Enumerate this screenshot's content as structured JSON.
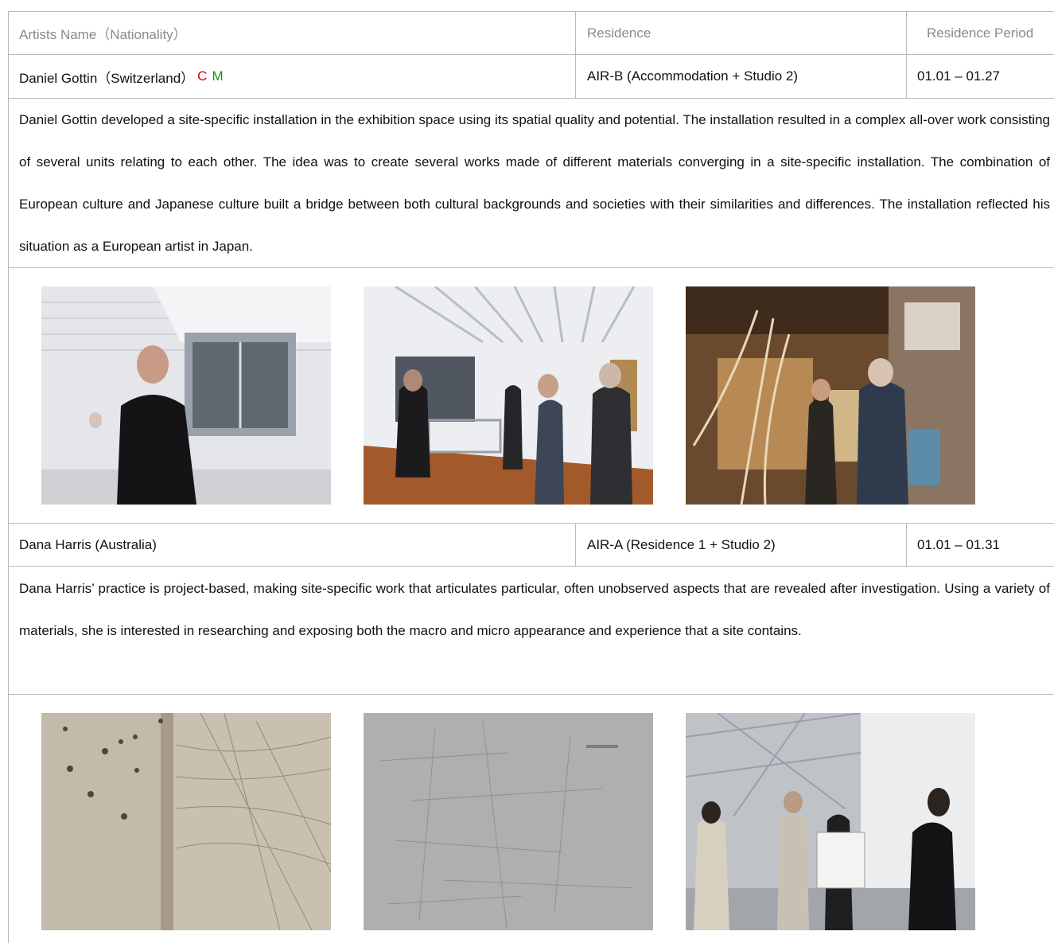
{
  "table": {
    "headers": {
      "artist": "Artists Name（Nationality）",
      "residence": "Residence",
      "period": "Residence Period"
    },
    "entries": [
      {
        "artist": "Daniel Gottin（Switzerland）",
        "marks": {
          "c": "C",
          "m": "M"
        },
        "residence": "AIR-B (Accommodation + Studio 2)",
        "period": "01.01 – 01.27",
        "description": "Daniel Gottin developed a site-specific installation in the exhibition space using its spatial quality and potential. The installation resulted in a complex all-over work consisting of several units relating to each other. The idea was to create several works made of different materials converging in a site-specific installation. The combination of European culture and Japanese culture built a bridge between both cultural backgrounds and societies with their similarities and differences. The installation reflected his situation as a European artist in Japan."
      },
      {
        "artist": "Dana Harris (Australia)",
        "residence": "AIR-A (Residence 1 + Studio 2)",
        "period": "01.01 – 01.31",
        "description": "Dana Harris’ practice is project-based, making site-specific work that articulates particular, often unobserved aspects that are revealed after investigation. Using a variety of materials, she is interested in researching and exposing both the macro and micro appearance and experience that a site contains."
      }
    ]
  }
}
